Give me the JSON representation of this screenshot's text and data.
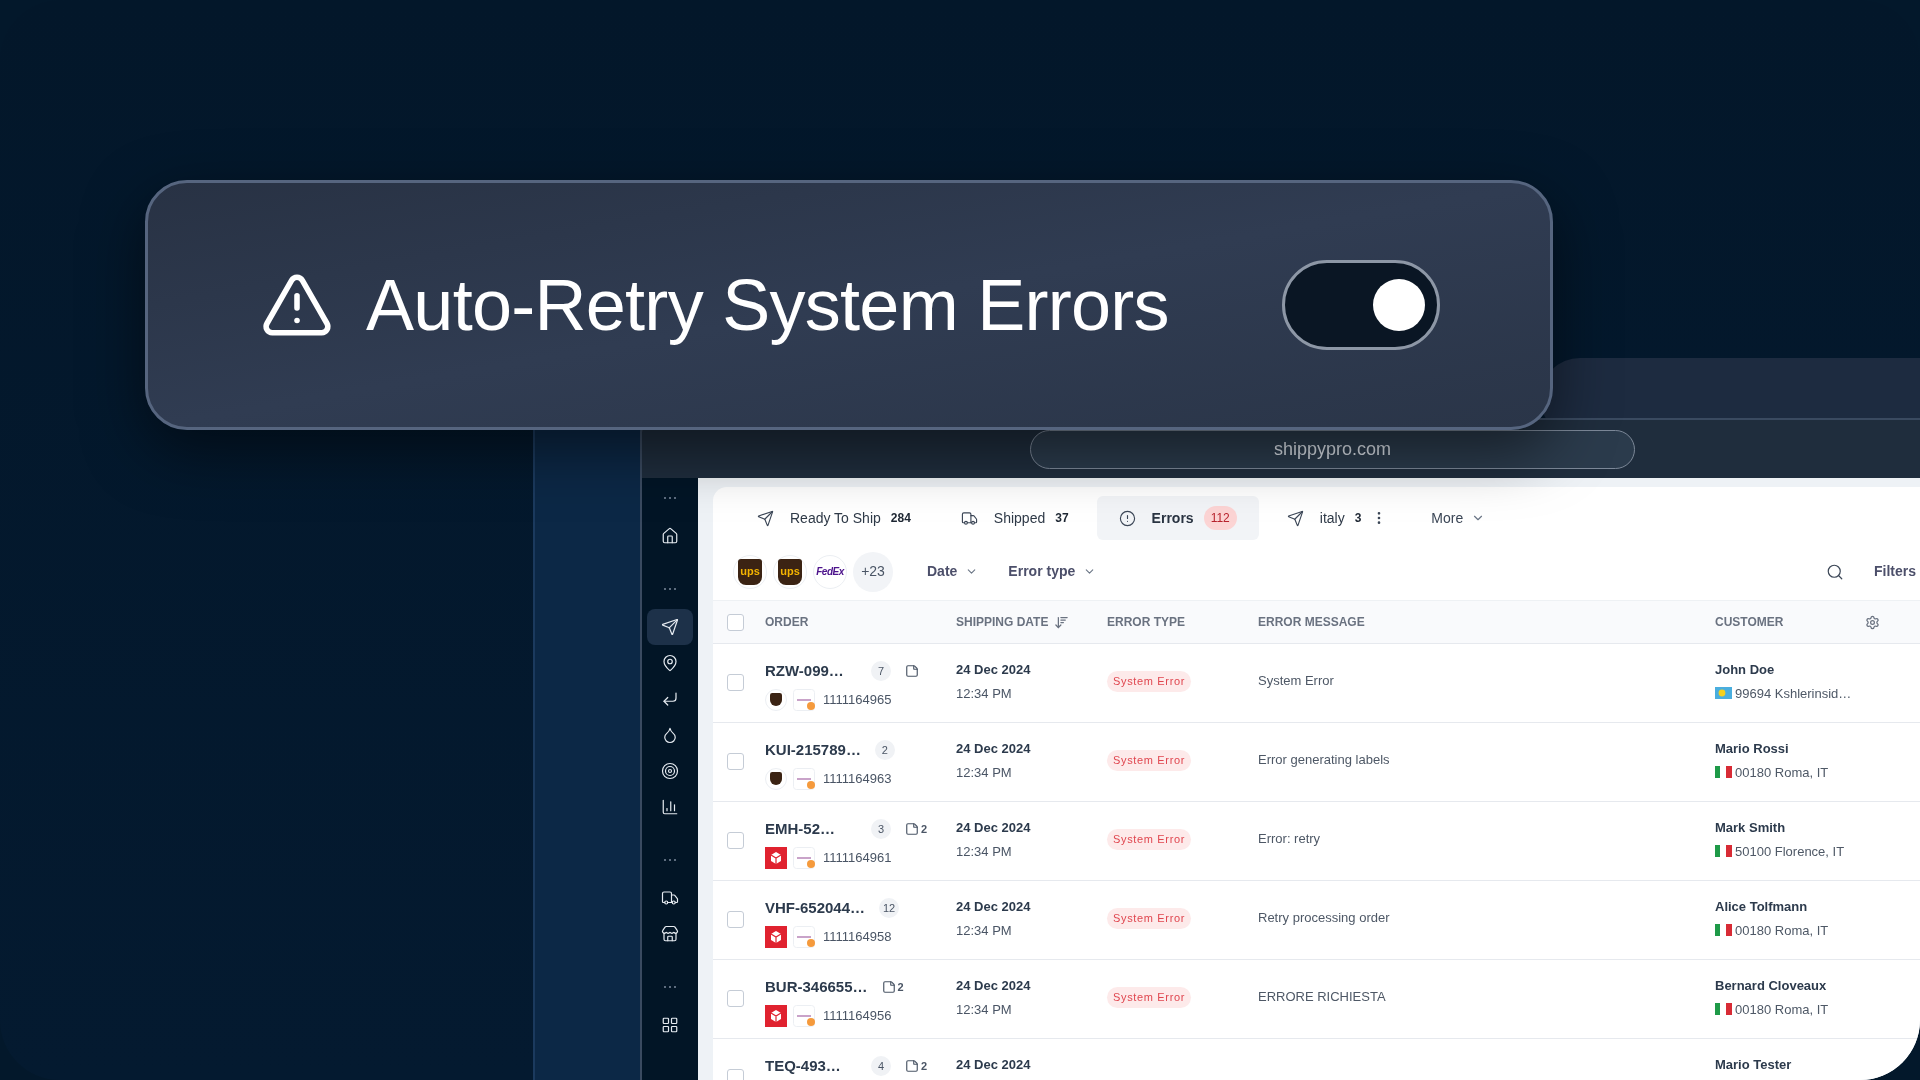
{
  "banner": {
    "title": "Auto-Retry System Errors",
    "toggle": {
      "on": true
    }
  },
  "browser": {
    "url": "shippypro.com"
  },
  "sidebar": {
    "items": [
      {
        "kind": "separator"
      },
      {
        "kind": "home",
        "selected": false
      },
      {
        "kind": "separator"
      },
      {
        "kind": "send",
        "selected": true
      },
      {
        "kind": "pin",
        "selected": false
      },
      {
        "kind": "return",
        "selected": false
      },
      {
        "kind": "drop",
        "selected": false
      },
      {
        "kind": "target",
        "selected": false
      },
      {
        "kind": "chart",
        "selected": false
      },
      {
        "kind": "separator"
      },
      {
        "kind": "truck",
        "selected": false
      },
      {
        "kind": "store",
        "selected": false
      },
      {
        "kind": "separator"
      },
      {
        "kind": "grid",
        "selected": false
      }
    ]
  },
  "tabs": [
    {
      "kind": "send",
      "label": "Ready To Ship",
      "count": "284",
      "selected": false
    },
    {
      "kind": "truck",
      "label": "Shipped",
      "count": "37",
      "selected": false
    },
    {
      "kind": "alert",
      "label": "Errors",
      "count": "112",
      "selected": true
    },
    {
      "kind": "send",
      "label": "italy",
      "count": "3",
      "selected": false,
      "menu": true
    }
  ],
  "more_menu": {
    "label": "More"
  },
  "filters": {
    "carriers": [
      {
        "kind": "ups",
        "label": "ups"
      },
      {
        "kind": "ups",
        "label": "ups"
      },
      {
        "kind": "fedex",
        "label": "FedEx"
      }
    ],
    "carriers_more": "+23",
    "dropdowns": [
      "Date",
      "Error type"
    ],
    "filters_label": "Filters"
  },
  "table": {
    "columns": [
      "ORDER",
      "SHIPPING DATE",
      "ERROR TYPE",
      "ERROR MESSAGE",
      "CUSTOMER"
    ],
    "header_checked": false,
    "rows": [
      {
        "order": "RZW-099…",
        "items": "7",
        "has_note": true,
        "carrier": {
          "kind": "ups"
        },
        "tracking": "1111164965",
        "date": "24 Dec 2024",
        "time": "12:34 PM",
        "error_type": "System Error",
        "message": "System Error",
        "customer": "John Doe",
        "flag": {
          "kind": "palau"
        },
        "address": "99694 Kshlerinsid…",
        "checked": false
      },
      {
        "order": "KUI-215789…",
        "items": "2",
        "has_note": false,
        "carrier": {
          "kind": "ups"
        },
        "tracking": "1111164963",
        "date": "24 Dec 2024",
        "time": "12:34 PM",
        "error_type": "System Error",
        "message": "Error generating labels",
        "customer": "Mario Rossi",
        "flag": {
          "kind": "italy"
        },
        "address": "00180 Roma, IT",
        "checked": false
      },
      {
        "order": "EMH-52…",
        "items": "3",
        "has_note": true,
        "note_count": "2",
        "carrier": {
          "kind": "parcel"
        },
        "tracking": "1111164961",
        "date": "24 Dec 2024",
        "time": "12:34 PM",
        "error_type": "System Error",
        "message": "Error: retry",
        "customer": "Mark Smith",
        "flag": {
          "kind": "italy"
        },
        "address": "50100 Florence, IT",
        "checked": false
      },
      {
        "order": "VHF-652044…",
        "items": "12",
        "has_note": false,
        "carrier": {
          "kind": "parcel"
        },
        "tracking": "1111164958",
        "date": "24 Dec 2024",
        "time": "12:34 PM",
        "error_type": "System Error",
        "message": "Retry processing order",
        "customer": "Alice Tolfmann",
        "flag": {
          "kind": "italy"
        },
        "address": "00180 Roma, IT",
        "checked": false
      },
      {
        "order": "BUR-346655…",
        "has_note": true,
        "note_count": "2",
        "carrier": {
          "kind": "parcel"
        },
        "tracking": "1111164956",
        "date": "24 Dec 2024",
        "time": "12:34 PM",
        "error_type": "System Error",
        "message": "ERRORE RICHIESTA",
        "customer": "Bernard Cloveaux",
        "flag": {
          "kind": "italy"
        },
        "address": "00180 Roma, IT",
        "checked": false
      },
      {
        "order": "TEQ-493…",
        "items": "4",
        "has_note": true,
        "note_count": "2",
        "date": "24 Dec 2024",
        "customer": "Mario Tester",
        "checked": false
      }
    ]
  }
}
